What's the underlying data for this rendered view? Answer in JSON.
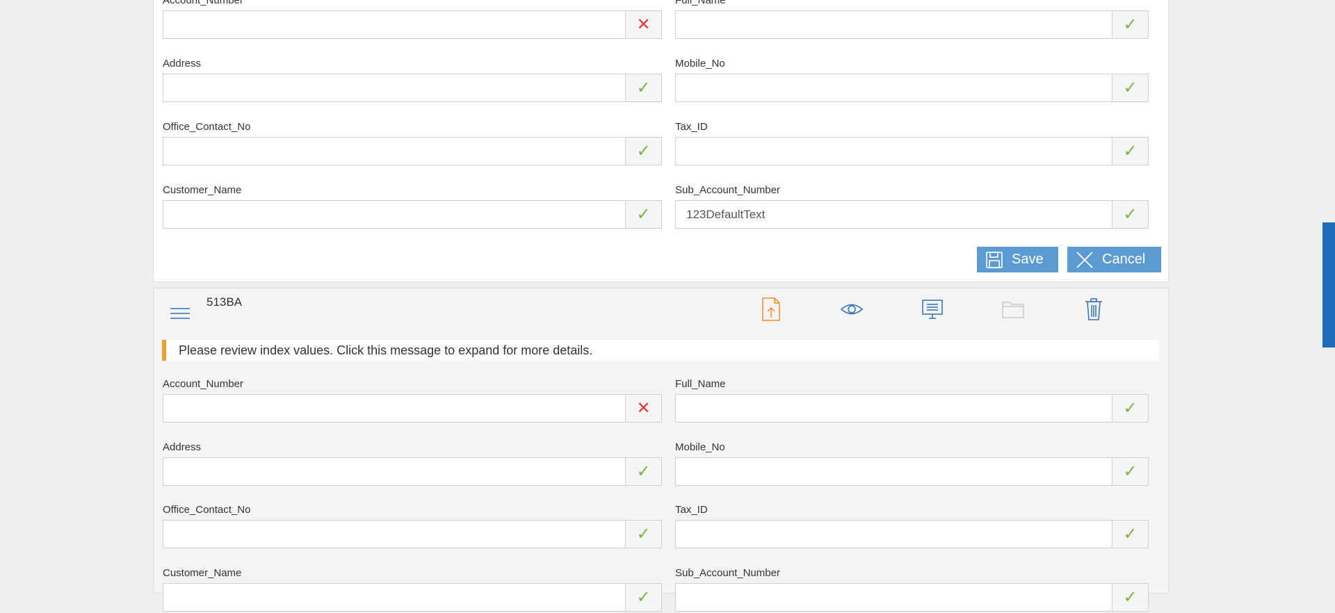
{
  "colors": {
    "accent": "#5b9bd1",
    "valid": "#7cb342",
    "invalid": "#e53935",
    "warning": "#f0a030",
    "scroll_thumb": "#1e6bb8"
  },
  "form1": {
    "fields": [
      {
        "label": "Account_Number",
        "value": "",
        "status": "invalid",
        "status_icon": "close-icon"
      },
      {
        "label": "Full_Name",
        "value": "",
        "status": "valid",
        "status_icon": "check-icon"
      },
      {
        "label": "Address",
        "value": "",
        "status": "valid",
        "status_icon": "check-icon"
      },
      {
        "label": "Mobile_No",
        "value": "",
        "status": "valid",
        "status_icon": "check-icon"
      },
      {
        "label": "Office_Contact_No",
        "value": "",
        "status": "valid",
        "status_icon": "check-icon"
      },
      {
        "label": "Tax_ID",
        "value": "",
        "status": "valid",
        "status_icon": "check-icon"
      },
      {
        "label": "Customer_Name",
        "value": "",
        "status": "valid",
        "status_icon": "check-icon"
      },
      {
        "label": "Sub_Account_Number",
        "value": "123DefaultText",
        "status": "valid",
        "status_icon": "check-icon"
      }
    ],
    "save_label": "Save",
    "cancel_label": "Cancel"
  },
  "document2": {
    "title": "513BA",
    "toolbar_icons": [
      "upload-file-icon",
      "eye-icon",
      "monitor-icon",
      "folder-icon",
      "trash-icon"
    ],
    "message": "Please review index values. Click this message to expand for more details.",
    "fields": [
      {
        "label": "Account_Number",
        "value": "",
        "status": "invalid",
        "status_icon": "close-icon"
      },
      {
        "label": "Full_Name",
        "value": "",
        "status": "valid",
        "status_icon": "check-icon"
      },
      {
        "label": "Address",
        "value": "",
        "status": "valid",
        "status_icon": "check-icon"
      },
      {
        "label": "Mobile_No",
        "value": "",
        "status": "valid",
        "status_icon": "check-icon"
      },
      {
        "label": "Office_Contact_No",
        "value": "",
        "status": "valid",
        "status_icon": "check-icon"
      },
      {
        "label": "Tax_ID",
        "value": "",
        "status": "valid",
        "status_icon": "check-icon"
      },
      {
        "label": "Customer_Name",
        "value": "",
        "status": "valid",
        "status_icon": "check-icon"
      },
      {
        "label": "Sub_Account_Number",
        "value": "",
        "status": "valid",
        "status_icon": "check-icon"
      }
    ]
  }
}
